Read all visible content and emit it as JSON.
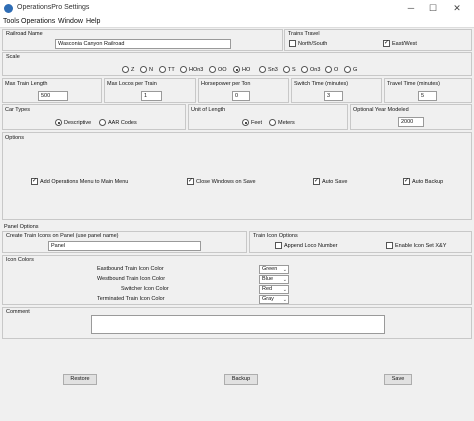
{
  "window": {
    "title": "OperationsPro Settings",
    "minimize": "─",
    "maximize": "☐",
    "close": "✕"
  },
  "menu": [
    "Tools",
    "Operations",
    "Window",
    "Help"
  ],
  "railroad": {
    "label": "Railroad Name",
    "value": "Wasconia Canyon Railroad"
  },
  "train_travel": {
    "label": "Trains Travel",
    "north_south": "North/South",
    "north_south_checked": false,
    "east_west": "East/West",
    "east_west_checked": true
  },
  "scale": {
    "label": "Scale",
    "options": [
      "Z",
      "N",
      "TT",
      "HOn3",
      "OO",
      "HO",
      "Sn3",
      "S",
      "On3",
      "O",
      "G"
    ],
    "selected": "HO"
  },
  "max_train_length": {
    "label": "Max Train Length",
    "value": "500"
  },
  "max_locos": {
    "label": "Max Locos per Train",
    "value": "1"
  },
  "hp_per_ton": {
    "label": "Horsepower per Ton",
    "value": "0"
  },
  "switch_time": {
    "label": "Switch Time (minutes)",
    "value": "3"
  },
  "travel_time": {
    "label": "Travel Time (minutes)",
    "value": "5"
  },
  "car_types": {
    "label": "Car Types",
    "descriptive": "Descriptive",
    "aar": "AAR Codes",
    "selected": "Descriptive"
  },
  "unit_length": {
    "label": "Unit of Length",
    "feet": "Feet",
    "meters": "Meters",
    "selected": "Feet"
  },
  "optional_year": {
    "label": "Optional Year Modeled",
    "value": "2000"
  },
  "options": {
    "label": "Options",
    "items": [
      {
        "label": "Add Operations Menu to Main Menu",
        "checked": true
      },
      {
        "label": "Close Windows on Save",
        "checked": true
      },
      {
        "label": "Auto Save",
        "checked": true
      },
      {
        "label": "Auto Backup",
        "checked": true
      }
    ]
  },
  "panel_options": {
    "label": "Panel Options",
    "create_label": "Create Train Icons on Panel (use panel name)",
    "panel_value": "Panel"
  },
  "train_icon_options": {
    "label": "Train Icon Options",
    "append_loco": "Append Loco Number",
    "append_checked": false,
    "enable_icon": "Enable Icon Set X&Y",
    "enable_checked": false
  },
  "icon_colors": {
    "label": "Icon Colors",
    "rows": [
      {
        "label": "Eastbound Train Icon Color",
        "value": "Green"
      },
      {
        "label": "Westbound Train Icon Color",
        "value": "Blue"
      },
      {
        "label": "Switcher Icon Color",
        "value": "Red"
      },
      {
        "label": "Terminated Train Icon Color",
        "value": "Gray"
      }
    ]
  },
  "comment": {
    "label": "Comment",
    "value": ""
  },
  "buttons": {
    "restore": "Restore",
    "backup": "Backup",
    "save": "Save"
  }
}
